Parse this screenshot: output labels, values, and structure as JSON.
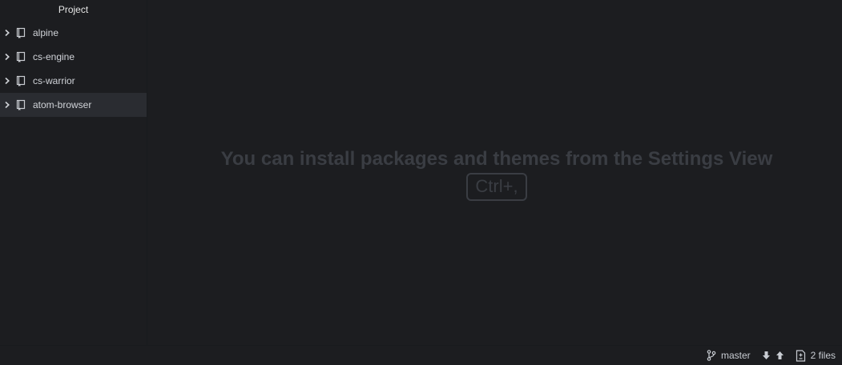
{
  "sidebar": {
    "title": "Project",
    "items": [
      {
        "label": "alpine",
        "icon": "repo-icon",
        "expanded": false,
        "selected": false
      },
      {
        "label": "cs-engine",
        "icon": "repo-icon",
        "expanded": false,
        "selected": false
      },
      {
        "label": "cs-warrior",
        "icon": "repo-icon",
        "expanded": false,
        "selected": false
      },
      {
        "label": "atom-browser",
        "icon": "repo-icon",
        "expanded": false,
        "selected": true
      }
    ]
  },
  "editor": {
    "message": "You can install packages and themes from the Settings View",
    "shortcut": "Ctrl+,"
  },
  "statusbar": {
    "branch": "master",
    "branch_icon": "git-branch-icon",
    "fetch_icon": "arrow-down-icon",
    "push_icon": "arrow-up-icon",
    "files": "2 files",
    "files_icon": "diff-file-icon"
  },
  "colors": {
    "background": "#1c1d20",
    "selected_item": "#2a2c31",
    "welcome_text": "#3a3d43"
  }
}
